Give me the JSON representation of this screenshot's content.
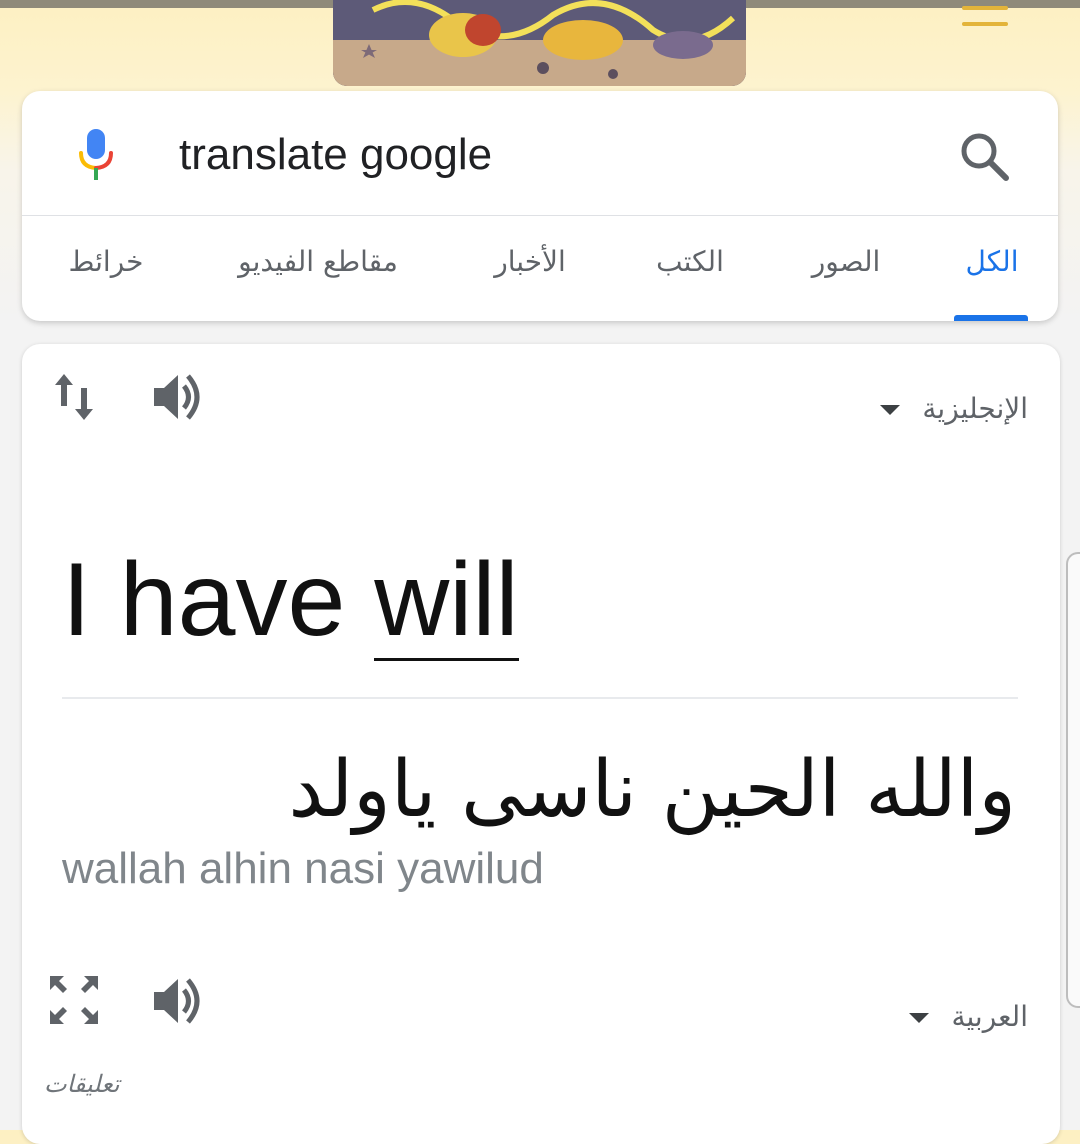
{
  "search": {
    "query": "translate google"
  },
  "tabs": [
    {
      "label": "الكل",
      "active": true
    },
    {
      "label": "الصور",
      "active": false
    },
    {
      "label": "الكتب",
      "active": false
    },
    {
      "label": "الأخبار",
      "active": false
    },
    {
      "label": "مقاطع الفيديو",
      "active": false
    },
    {
      "label": "خرائط",
      "active": false
    }
  ],
  "translator": {
    "source_language": "الإنجليزية",
    "source_text_prefix": "I have ",
    "source_text_underlined": "will",
    "target_language": "العربية",
    "translated_text": "والله الحين ناسى ياولد",
    "transliteration": "wallah alhin nasi yawilud",
    "feedback_label": "تعليقات"
  },
  "icons": {
    "mic": "microphone-icon",
    "search": "magnifier-icon",
    "swap": "swap-languages-icon",
    "speaker": "speaker-icon",
    "expand": "expand-fullscreen-icon",
    "menu": "hamburger-menu-icon"
  },
  "colors": {
    "accent": "#1a73e8",
    "doodle_bg": "#fdf0c2",
    "menu": "#e3b43a"
  }
}
